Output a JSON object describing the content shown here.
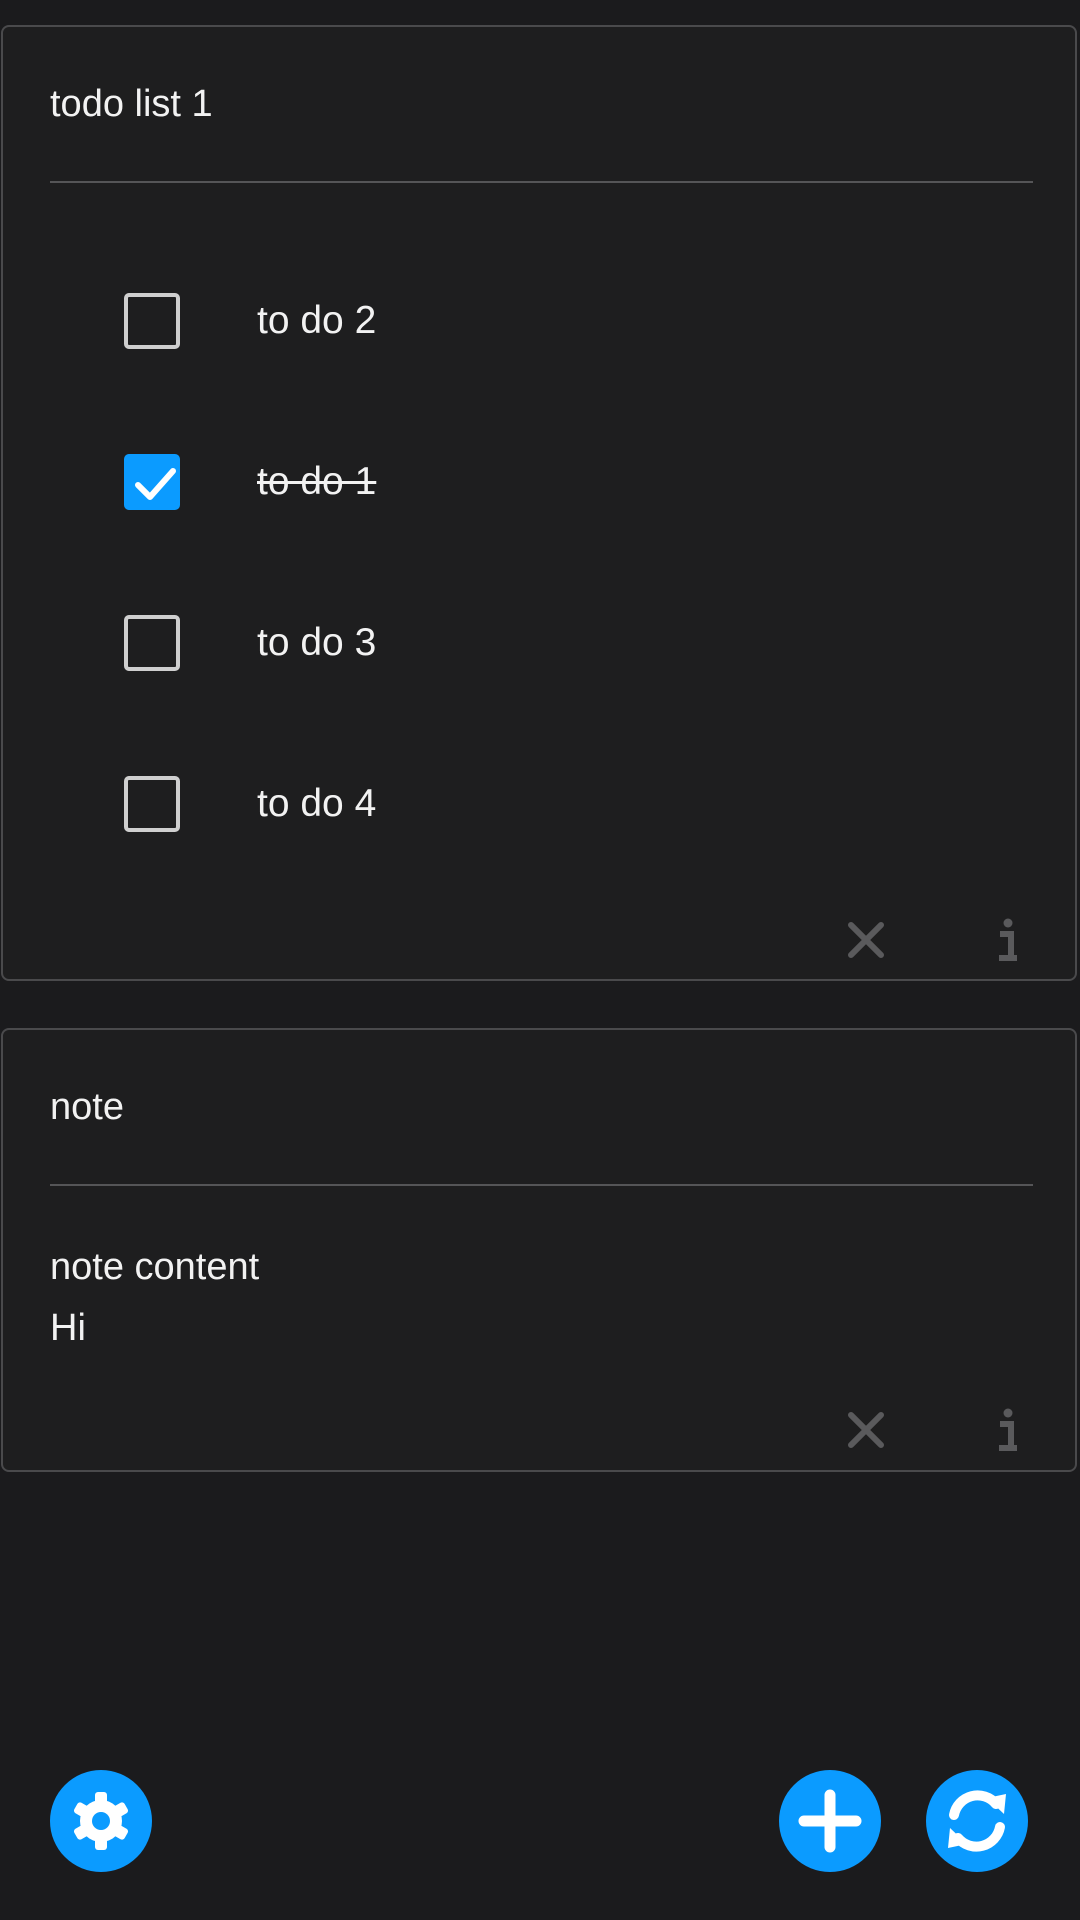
{
  "todo_card": {
    "title": "todo list 1",
    "items": [
      {
        "label": "to do 2",
        "checked": false
      },
      {
        "label": "to do 1",
        "checked": true
      },
      {
        "label": "to do 3",
        "checked": false
      },
      {
        "label": "to do 4",
        "checked": false
      }
    ],
    "actions": {
      "close_icon": "close-icon",
      "info_icon": "info-icon"
    }
  },
  "note_card": {
    "title": "note",
    "content": "note content\nHi",
    "actions": {
      "close_icon": "close-icon",
      "info_icon": "info-icon"
    }
  },
  "fabs": {
    "settings_icon": "gear-icon",
    "add_icon": "plus-icon",
    "sync_icon": "sync-icon"
  },
  "colors": {
    "accent": "#0b9bff",
    "background": "#1b1b1d",
    "card": "#1e1e1f",
    "muted_icon": "#5a5a5c"
  }
}
